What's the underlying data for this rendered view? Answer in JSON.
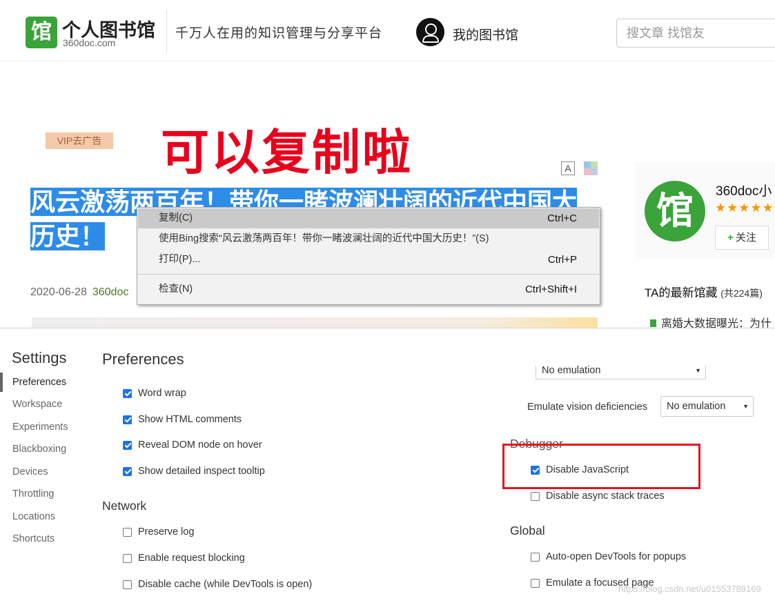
{
  "site": {
    "logo_glyph": "馆",
    "logo_title": "个人图书馆",
    "logo_domain": "360doc.com",
    "slogan": "千万人在用的知识管理与分享平台",
    "my_library": "我的图书馆",
    "search_placeholder": "搜文章 找馆友"
  },
  "article": {
    "vip_label": "VIP去广告",
    "font_toggle": "A",
    "title": "风云激荡两百年！带你一睹波澜壮阔的近代中国大历史！",
    "date": "2020-06-28",
    "source": "360doc"
  },
  "overlay_caption": "可以复制啦",
  "author_card": {
    "avatar_glyph": "馆",
    "name": "360doc小",
    "stars": "★★★★★",
    "follow": "关注",
    "latest_title": "TA的最新馆藏",
    "latest_count": "(共224篇)",
    "latest_item": "离婚大数据曝光：为什"
  },
  "context_menu": {
    "items": [
      {
        "label": "复制(C)",
        "shortcut": "Ctrl+C"
      },
      {
        "label": "使用Bing搜索“风云激荡两百年！带你一睹波澜壮阔的近代中国大历史！”(S)",
        "shortcut": ""
      },
      {
        "label": "打印(P)...",
        "shortcut": "Ctrl+P"
      },
      {
        "label": "检查(N)",
        "shortcut": "Ctrl+Shift+I"
      }
    ]
  },
  "devtools": {
    "settings_title": "Settings",
    "nav": [
      "Preferences",
      "Workspace",
      "Experiments",
      "Blackboxing",
      "Devices",
      "Throttling",
      "Locations",
      "Shortcuts"
    ],
    "preferences_heading": "Preferences",
    "elements_opts": [
      {
        "label": "Word wrap",
        "checked": true
      },
      {
        "label": "Show HTML comments",
        "checked": true
      },
      {
        "label": "Reveal DOM node on hover",
        "checked": true
      },
      {
        "label": "Show detailed inspect tooltip",
        "checked": true
      }
    ],
    "network_heading": "Network",
    "network_opts": [
      {
        "label": "Preserve log",
        "checked": false
      },
      {
        "label": "Enable request blocking",
        "checked": false
      },
      {
        "label": "Disable cache (while DevTools is open)",
        "checked": false
      }
    ],
    "emulation_top_value": "No emulation",
    "vision_label": "Emulate vision deficiencies",
    "vision_value": "No emulation",
    "debugger_heading": "Debugger",
    "debugger_opts": [
      {
        "label": "Disable JavaScript",
        "checked": true
      },
      {
        "label": "Disable async stack traces",
        "checked": false
      }
    ],
    "global_heading": "Global",
    "global_opts": [
      {
        "label": "Auto-open DevTools for popups",
        "checked": false
      },
      {
        "label": "Emulate a focused page",
        "checked": false
      }
    ]
  },
  "watermark": "https://blog.csdn.net/u01553789169",
  "colors": {
    "brand_green": "#3aa33a",
    "selection_blue": "#2d8ce8",
    "caption_red": "#e8001c",
    "checkbox_blue": "#1a73e8"
  }
}
